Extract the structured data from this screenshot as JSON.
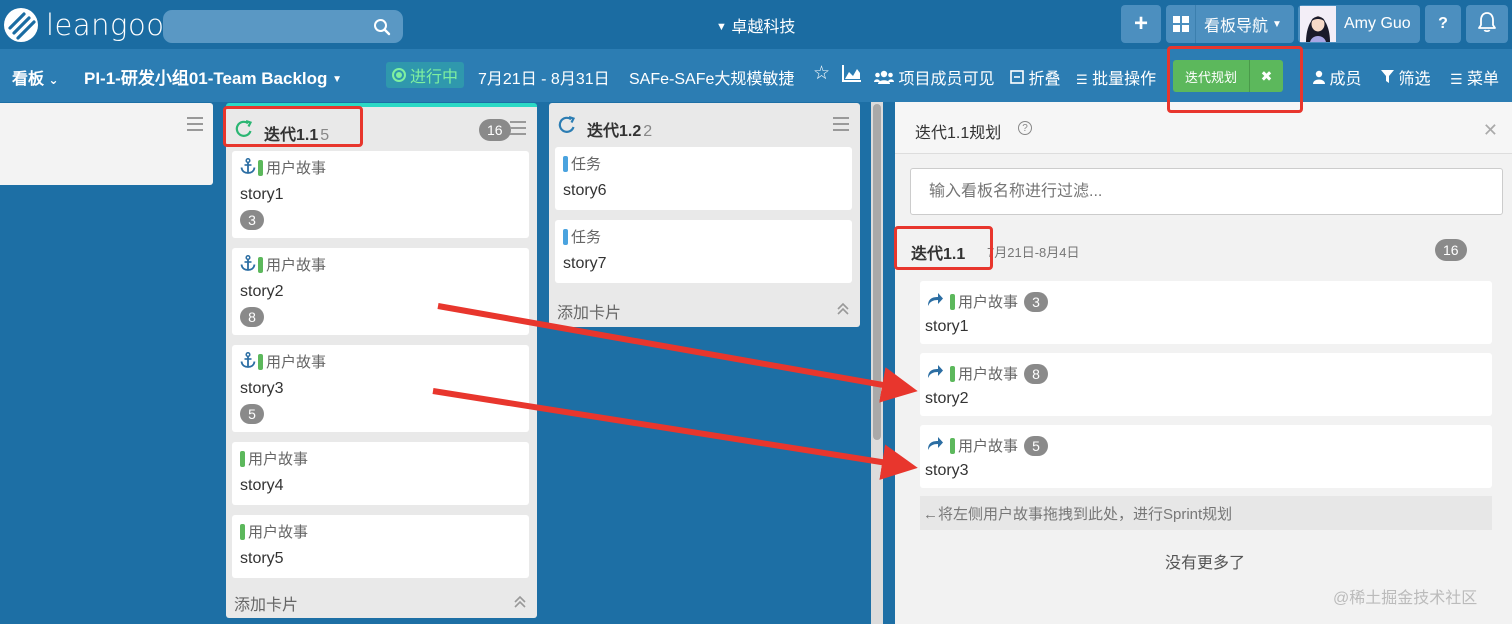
{
  "topbar": {
    "logo_text": "leangoo",
    "org_name": "卓越科技",
    "nav_label": "看板导航",
    "user_name": "Amy Guo",
    "help_label": "?"
  },
  "boardbar": {
    "board_menu": "看板",
    "board_name": "PI-1-研发小组01-Team Backlog",
    "status": "进行中",
    "date_range": "7月21日 - 8月31日",
    "project": "SAFe-SAFe大规模敏捷",
    "visibility": "项目成员可见",
    "fold": "折叠",
    "batch": "批量操作",
    "plan_button": "迭代规划",
    "members": "成员",
    "filter": "筛选",
    "menu": "菜单"
  },
  "columns": [
    {
      "title": "迭代1.1",
      "count": "5",
      "badge": "16",
      "add_card": "添加卡片",
      "cards": [
        {
          "type": "用户故事",
          "name": "story1",
          "points": "3",
          "anchor": true,
          "color": "#5cb85c"
        },
        {
          "type": "用户故事",
          "name": "story2",
          "points": "8",
          "anchor": true,
          "color": "#5cb85c"
        },
        {
          "type": "用户故事",
          "name": "story3",
          "points": "5",
          "anchor": true,
          "color": "#5cb85c"
        },
        {
          "type": "用户故事",
          "name": "story4",
          "points": "",
          "anchor": false,
          "color": "#5cb85c"
        },
        {
          "type": "用户故事",
          "name": "story5",
          "points": "",
          "anchor": false,
          "color": "#5cb85c"
        }
      ]
    },
    {
      "title": "迭代1.2",
      "count": "2",
      "add_card": "添加卡片",
      "cards": [
        {
          "type": "任务",
          "name": "story6",
          "color": "#4aa3df"
        },
        {
          "type": "任务",
          "name": "story7",
          "color": "#4aa3df"
        }
      ]
    }
  ],
  "panel": {
    "title": "迭代1.1规划",
    "help": "?",
    "filter_placeholder": "输入看板名称进行过滤...",
    "sprint_name": "迭代1.1",
    "sprint_dates": "7月21日-8月4日",
    "sprint_badge": "16",
    "cards": [
      {
        "type": "用户故事",
        "points": "3",
        "name": "story1"
      },
      {
        "type": "用户故事",
        "points": "8",
        "name": "story2"
      },
      {
        "type": "用户故事",
        "points": "5",
        "name": "story3"
      }
    ],
    "hint": "←将左侧用户故事拖拽到此处，进行Sprint规划",
    "no_more": "没有更多了"
  },
  "watermark": "@稀土掘金技术社区",
  "colors": {
    "topbar": "#1b6ca2",
    "boardbar": "#2c7db3",
    "accent_green": "#5cb85c",
    "task_blue": "#4aa3df",
    "annotation_red": "#e8362d"
  }
}
